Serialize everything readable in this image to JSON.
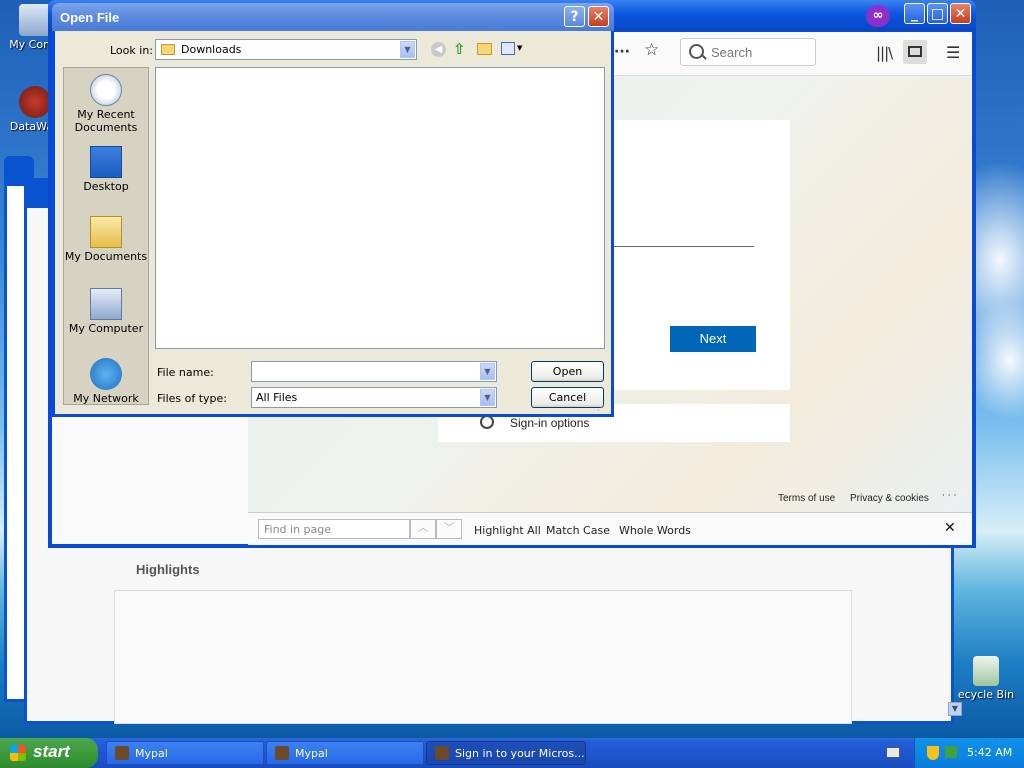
{
  "desktop": {
    "icons": [
      {
        "label": "My Comp",
        "icon": "computer-icon"
      },
      {
        "label": "DataWag",
        "icon": "shortcut-icon"
      },
      {
        "label": "ecycle Bin",
        "icon": "recycle-bin-icon"
      }
    ]
  },
  "browser": {
    "search_placeholder": "Search",
    "page": {
      "next_label": "Next",
      "signin_options_label": "Sign-in options",
      "footer_terms": "Terms of use",
      "footer_privacy": "Privacy & cookies",
      "footer_more": "· · ·"
    },
    "findbar": {
      "placeholder": "Find in page",
      "highlight_all": "Highlight All",
      "match_case": "Match Case",
      "whole_words": "Whole Words"
    }
  },
  "background_window": {
    "section_heading": "Highlights"
  },
  "dialog": {
    "title": "Open File",
    "look_in_label": "Look in:",
    "look_in_value": "Downloads",
    "places": [
      "My Recent Documents",
      "Desktop",
      "My Documents",
      "My Computer",
      "My Network"
    ],
    "file_name_label": "File name:",
    "file_name_value": "",
    "files_of_type_label": "Files of type:",
    "files_of_type_value": "All Files",
    "open_label": "Open",
    "cancel_label": "Cancel"
  },
  "taskbar": {
    "start_label": "start",
    "tasks": [
      "Mypal",
      "Mypal",
      "Sign in to your Micros..."
    ],
    "active_task_index": 2,
    "clock": "5:42 AM"
  },
  "colors": {
    "xp_blue": "#0a4bd4",
    "ms_next_blue": "#0067b8",
    "start_green": "#3c9a3c"
  }
}
